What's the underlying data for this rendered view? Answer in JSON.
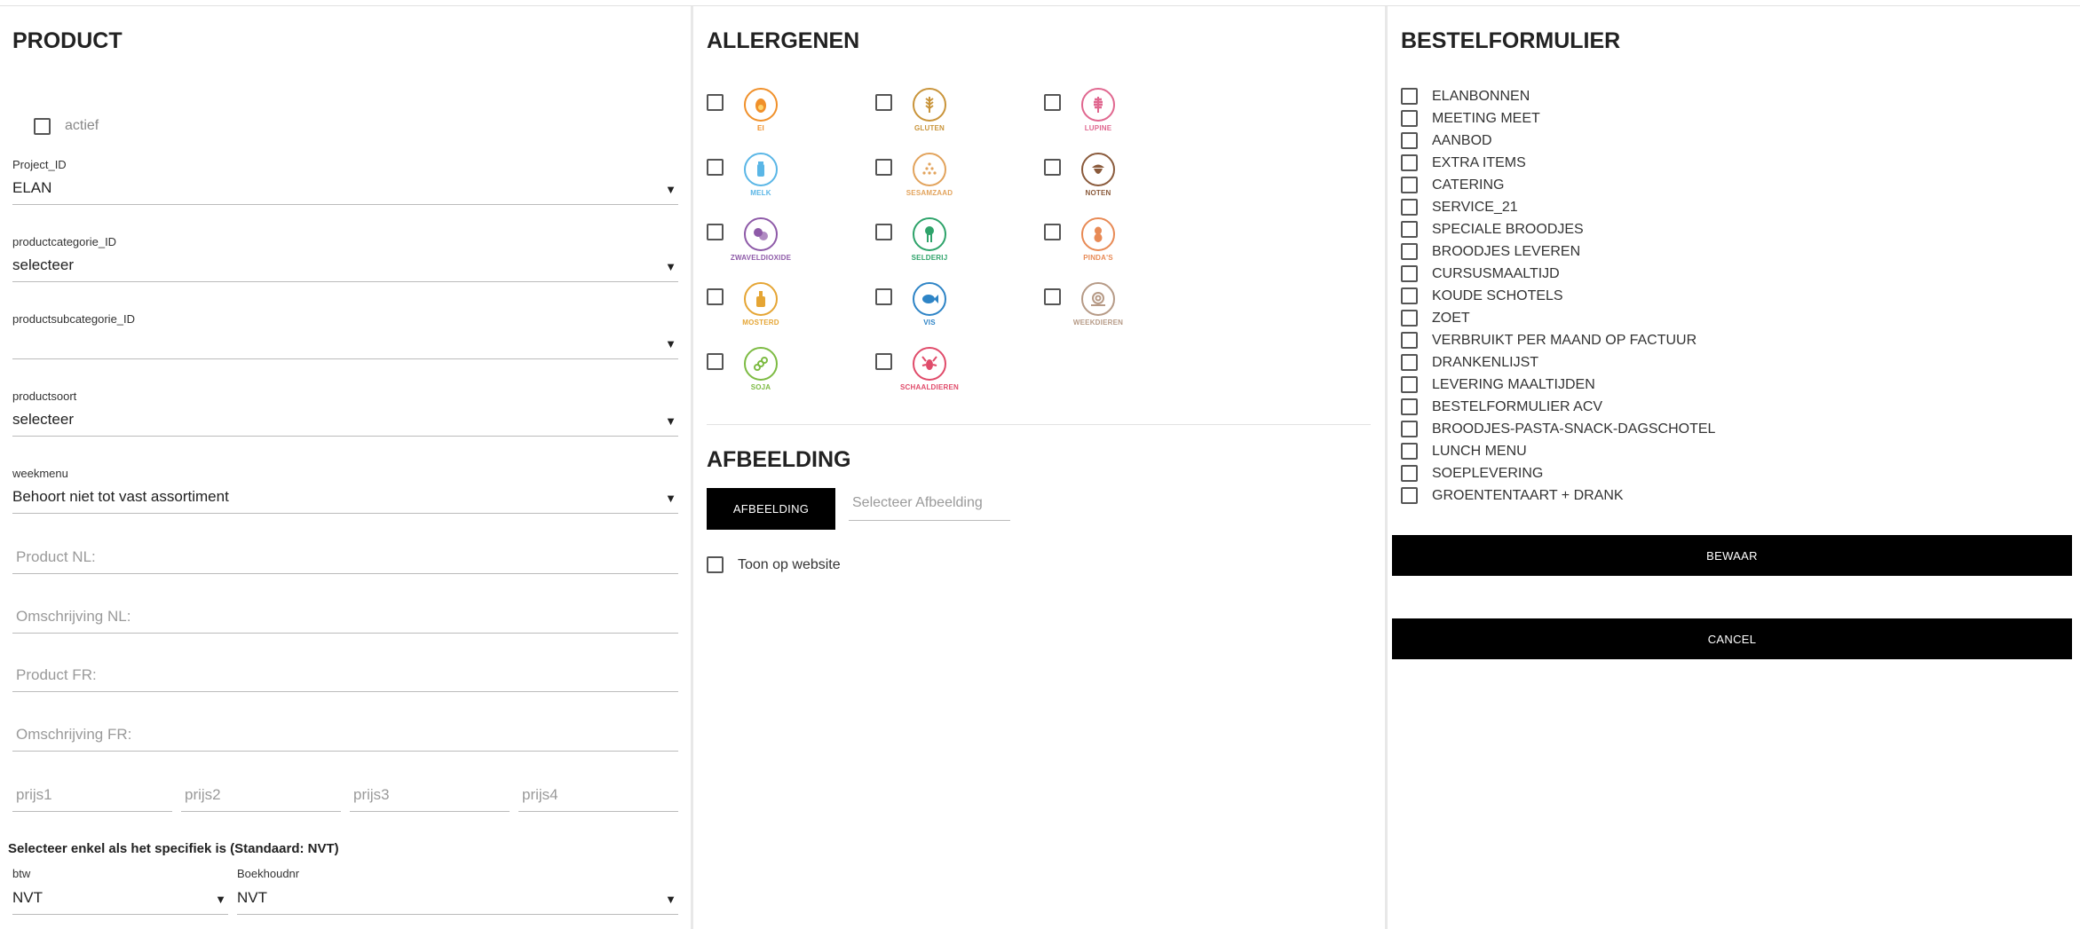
{
  "product": {
    "heading": "PRODUCT",
    "actief_label": "actief",
    "project_label": "Project_ID",
    "project_value": "ELAN",
    "productcategorie_label": "productcategorie_ID",
    "productcategorie_value": "selecteer",
    "productsubcategorie_label": "productsubcategorie_ID",
    "productsubcategorie_value": "",
    "productsoort_label": "productsoort",
    "productsoort_value": "selecteer",
    "weekmenu_label": "weekmenu",
    "weekmenu_value": "Behoort niet tot vast assortiment",
    "product_nl_placeholder": "Product NL:",
    "omschrijving_nl_placeholder": "Omschrijving NL:",
    "product_fr_placeholder": "Product FR:",
    "omschrijving_fr_placeholder": "Omschrijving FR:",
    "prijs1_placeholder": "prijs1",
    "prijs2_placeholder": "prijs2",
    "prijs3_placeholder": "prijs3",
    "prijs4_placeholder": "prijs4",
    "note": "Selecteer enkel als het specifiek is (Standaard: NVT)",
    "btw_label": "btw",
    "btw_value": "NVT",
    "boekhoudnr_label": "Boekhoudnr",
    "boekhoudnr_value": "NVT",
    "dropdown_arrow": "▼"
  },
  "allergenen": {
    "heading": "ALLERGENEN",
    "items": [
      {
        "label": "EI",
        "icon": "egg-icon",
        "color": "#f0902a"
      },
      {
        "label": "GLUTEN",
        "icon": "wheat-icon",
        "color": "#c9943a"
      },
      {
        "label": "LUPINE",
        "icon": "lupine-icon",
        "color": "#e0678f"
      },
      {
        "label": "MELK",
        "icon": "milk-icon",
        "color": "#5ab6e6"
      },
      {
        "label": "SESAMZAAD",
        "icon": "sesame-icon",
        "color": "#e2a35c"
      },
      {
        "label": "NOTEN",
        "icon": "nut-icon",
        "color": "#8a5a3b"
      },
      {
        "label": "ZWAVELDIOXIDE",
        "icon": "sulphite-icon",
        "color": "#8e5aa8"
      },
      {
        "label": "SELDERIJ",
        "icon": "celery-icon",
        "color": "#2ea36a"
      },
      {
        "label": "PINDA'S",
        "icon": "peanut-icon",
        "color": "#e88a55"
      },
      {
        "label": "MOSTERD",
        "icon": "mustard-icon",
        "color": "#e5a534"
      },
      {
        "label": "VIS",
        "icon": "fish-icon",
        "color": "#2e84c6"
      },
      {
        "label": "WEEKDIEREN",
        "icon": "snail-icon",
        "color": "#b69a86"
      },
      {
        "label": "SOJA",
        "icon": "soy-icon",
        "color": "#7dbb43"
      },
      {
        "label": "SCHAALDIEREN",
        "icon": "lobster-icon",
        "color": "#e04b6a"
      }
    ]
  },
  "afbeelding": {
    "heading": "AFBEELDING",
    "button_label": "AFBEELDING",
    "file_placeholder": "Selecteer Afbeelding",
    "toon_label": "Toon op website"
  },
  "bestelformulier": {
    "heading": "BESTELFORMULIER",
    "items": [
      "ELANBONNEN",
      "MEETING MEET",
      "AANBOD",
      "EXTRA ITEMS",
      "CATERING",
      "SERVICE_21",
      "SPECIALE BROODJES",
      "BROODJES LEVEREN",
      "CURSUSMAALTIJD",
      "KOUDE SCHOTELS",
      "ZOET",
      "VERBRUIKT PER MAAND OP FACTUUR",
      "DRANKENLIJST",
      "LEVERING MAALTIJDEN",
      "BESTELFORMULIER ACV",
      "BROODJES-PASTA-SNACK-DAGSCHOTEL",
      "LUNCH MENU",
      "SOEPLEVERING",
      "GROENTENTAART + DRANK"
    ],
    "save_label": "BEWAAR",
    "cancel_label": "CANCEL"
  }
}
